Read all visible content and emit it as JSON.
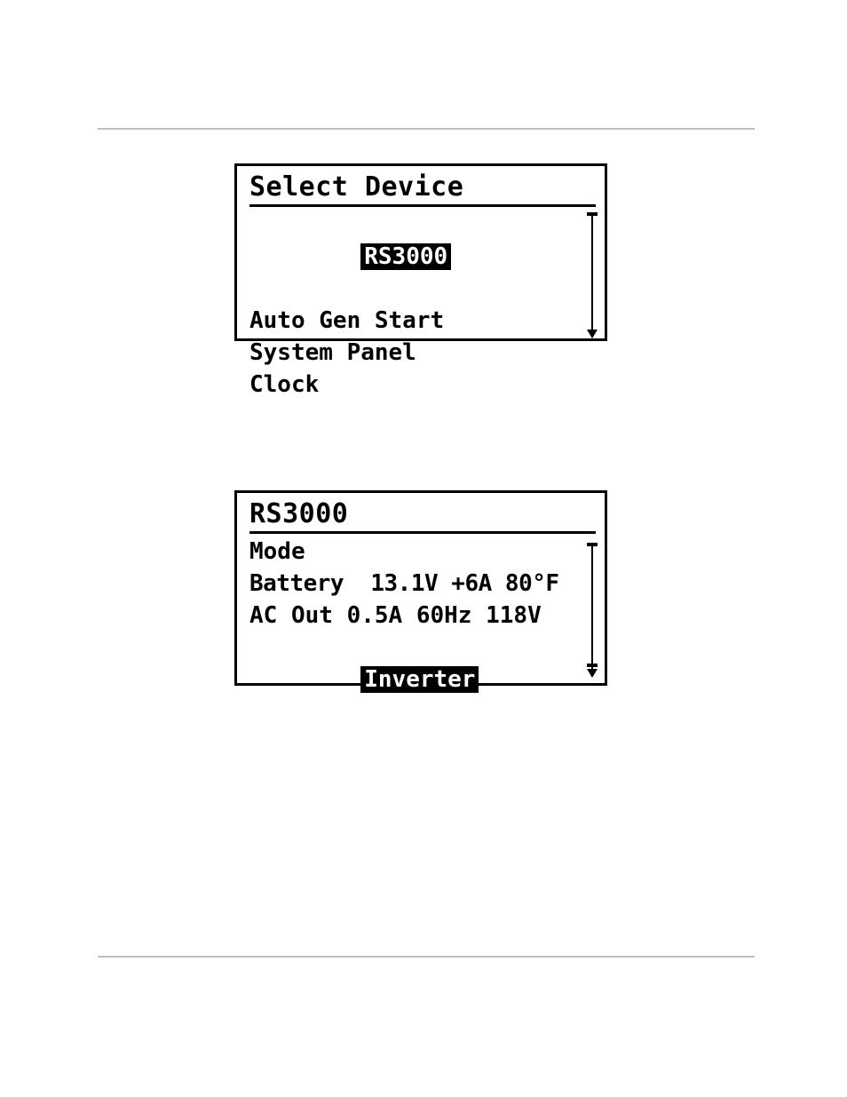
{
  "panel1": {
    "title": "Select Device",
    "items": [
      "RS3000",
      "Auto Gen Start",
      "System Panel",
      "Clock"
    ],
    "selected_index": 0
  },
  "panel2": {
    "title": "RS3000",
    "lines": {
      "mode": "Mode",
      "battery": "Battery  13.1V +6A 80°F",
      "ac_out": "AC Out 0.5A 60Hz 118V",
      "inverter": "Inverter"
    }
  }
}
